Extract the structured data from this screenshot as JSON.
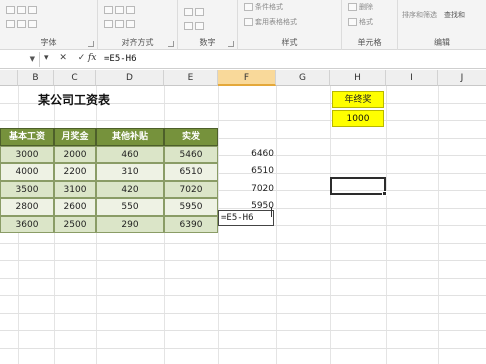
{
  "ribbon": {
    "groups": [
      {
        "label": "字体"
      },
      {
        "label": "对齐方式"
      },
      {
        "label": "数字"
      },
      {
        "label": "样式"
      },
      {
        "label": "单元格"
      },
      {
        "label": "编辑"
      }
    ],
    "buttons": {
      "cond_format": "条件格式",
      "table_format": "套用表格格式",
      "cell_style": "单元格样式",
      "delete": "删除",
      "format": "格式",
      "sort_filter": "排序和筛选",
      "find_select": "查找和"
    }
  },
  "formula_bar": {
    "name_box": "",
    "buttons": "▾ ✕ ✓",
    "fx": "fx",
    "formula": "=E5-H6"
  },
  "columns": [
    "B",
    "C",
    "D",
    "E",
    "F",
    "G",
    "H",
    "I",
    "J"
  ],
  "sheet": {
    "title": "某公司工资表",
    "headers": [
      "基本工资",
      "月奖金",
      "其他补贴",
      "实发"
    ],
    "rows": [
      [
        "3000",
        "2000",
        "460",
        "5460"
      ],
      [
        "4000",
        "2200",
        "310",
        "6510"
      ],
      [
        "3500",
        "3100",
        "420",
        "7020"
      ],
      [
        "2800",
        "2600",
        "550",
        "5950"
      ],
      [
        "3600",
        "2500",
        "290",
        "6390"
      ]
    ],
    "f_values": [
      "6460",
      "6510",
      "7020",
      "5950"
    ],
    "editing_formula": "=E5-H6",
    "bonus_label": "年终奖",
    "bonus_value": "1000"
  },
  "colors": {
    "header_green": "#76923c",
    "row_green": "#dbe5c8",
    "bonus_yellow": "#ffff00",
    "selected_col": "#f9d99a"
  }
}
